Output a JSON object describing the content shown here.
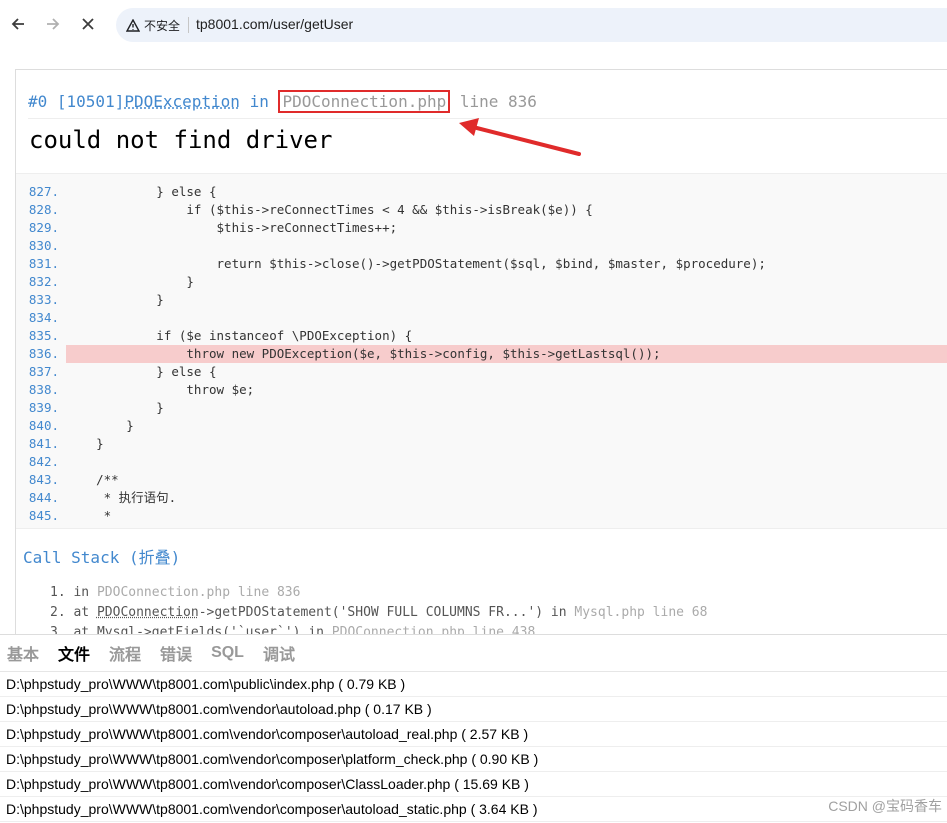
{
  "browser": {
    "security_label": "不安全",
    "url": "tp8001.com/user/getUser"
  },
  "error": {
    "prefix": "#0 [10501]",
    "exception_class": "PDOException",
    "in_word": "in",
    "file": "PDOConnection.php",
    "line_text": "line 836",
    "message": "could not find driver"
  },
  "source": {
    "highlight_line": "836.",
    "lines": [
      {
        "num": "827.",
        "text": "            } else {"
      },
      {
        "num": "828.",
        "text": "                if ($this->reConnectTimes < 4 && $this->isBreak($e)) {"
      },
      {
        "num": "829.",
        "text": "                    $this->reConnectTimes++;"
      },
      {
        "num": "830.",
        "text": ""
      },
      {
        "num": "831.",
        "text": "                    return $this->close()->getPDOStatement($sql, $bind, $master, $procedure);"
      },
      {
        "num": "832.",
        "text": "                }"
      },
      {
        "num": "833.",
        "text": "            }"
      },
      {
        "num": "834.",
        "text": ""
      },
      {
        "num": "835.",
        "text": "            if ($e instanceof \\PDOException) {"
      },
      {
        "num": "836.",
        "text": "                throw new PDOException($e, $this->config, $this->getLastsql());"
      },
      {
        "num": "837.",
        "text": "            } else {"
      },
      {
        "num": "838.",
        "text": "                throw $e;"
      },
      {
        "num": "839.",
        "text": "            }"
      },
      {
        "num": "840.",
        "text": "        }"
      },
      {
        "num": "841.",
        "text": "    }"
      },
      {
        "num": "842.",
        "text": ""
      },
      {
        "num": "843.",
        "text": "    /**"
      },
      {
        "num": "844.",
        "text": "     * 执行语句."
      },
      {
        "num": "845.",
        "text": "     *"
      }
    ]
  },
  "call_stack": {
    "title": "Call Stack (折叠)",
    "items": [
      {
        "n": "1.",
        "kw": "in",
        "rest": "PDOConnection.php line 836"
      },
      {
        "n": "2.",
        "kw": "at",
        "cls": "PDOConnection",
        "call": "->getPDOStatement('SHOW FULL COLUMNS FR...')",
        "kw2": "in",
        "rest": "Mysql.php line 68"
      },
      {
        "n": "3.",
        "kw": "at",
        "cls": "Mysql",
        "call": "->getFields('`user`')",
        "kw2": "in",
        "rest": "PDOConnection.php line 438"
      }
    ]
  },
  "debug": {
    "tabs": [
      "基本",
      "文件",
      "流程",
      "错误",
      "SQL",
      "调试"
    ],
    "active_tab": 1,
    "files": [
      "D:\\phpstudy_pro\\WWW\\tp8001.com\\public\\index.php ( 0.79 KB )",
      "D:\\phpstudy_pro\\WWW\\tp8001.com\\vendor\\autoload.php ( 0.17 KB )",
      "D:\\phpstudy_pro\\WWW\\tp8001.com\\vendor\\composer\\autoload_real.php ( 2.57 KB )",
      "D:\\phpstudy_pro\\WWW\\tp8001.com\\vendor\\composer\\platform_check.php ( 0.90 KB )",
      "D:\\phpstudy_pro\\WWW\\tp8001.com\\vendor\\composer\\ClassLoader.php ( 15.69 KB )",
      "D:\\phpstudy_pro\\WWW\\tp8001.com\\vendor\\composer\\autoload_static.php ( 3.64 KB )"
    ]
  },
  "watermark": "CSDN @宝码香车",
  "colors": {
    "link_blue": "#4288ce",
    "highlight": "#f7cccc",
    "annotation_red": "#e02b2b"
  }
}
